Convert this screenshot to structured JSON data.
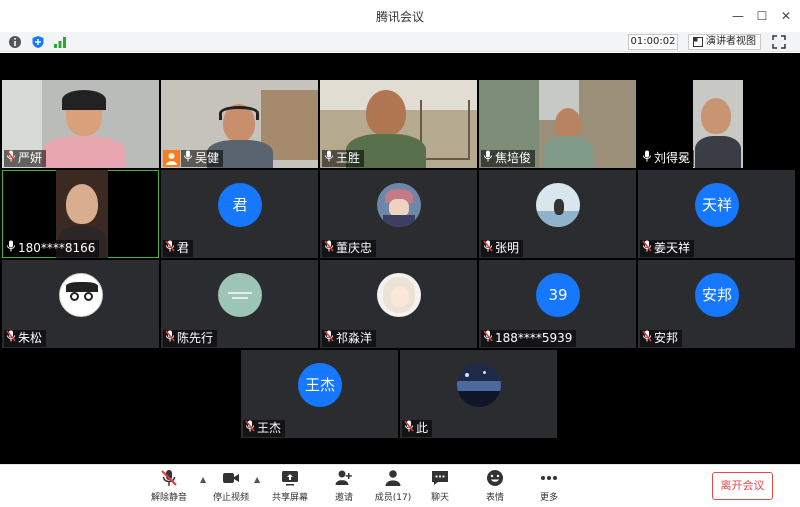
{
  "window": {
    "title": "腾讯会议",
    "minimize": "—",
    "maximize": "☐",
    "close": "✕"
  },
  "infobar": {
    "icons": [
      "info-icon",
      "shield-icon",
      "signal-icon"
    ],
    "timer": "01:00:02",
    "speaker_view": "演讲者视图",
    "fullscreen_icon": "fullscreen-icon"
  },
  "participants": [
    {
      "name": "严妍",
      "kind": "video",
      "muted": true
    },
    {
      "name": "吴健",
      "kind": "video",
      "muted": false,
      "host": true
    },
    {
      "name": "王胜",
      "kind": "video",
      "muted": false
    },
    {
      "name": "焦培俊",
      "kind": "video",
      "muted": false
    },
    {
      "name": "刘得冕",
      "kind": "video",
      "muted": false
    },
    {
      "name": "180****8166",
      "kind": "video",
      "muted": false,
      "active": true
    },
    {
      "name": "君",
      "kind": "avatar-text",
      "avatar_text": "君",
      "muted": true
    },
    {
      "name": "董庆忠",
      "kind": "avatar-image",
      "muted": true
    },
    {
      "name": "张明",
      "kind": "avatar-image",
      "muted": true
    },
    {
      "name": "姜天祥",
      "kind": "avatar-text",
      "avatar_text": "天祥",
      "muted": true
    },
    {
      "name": "朱松",
      "kind": "avatar-image",
      "muted": true
    },
    {
      "name": "陈先行",
      "kind": "avatar-image",
      "muted": true
    },
    {
      "name": "祁淼洋",
      "kind": "avatar-image",
      "muted": true
    },
    {
      "name": "188****5939",
      "kind": "avatar-text",
      "avatar_text": "39",
      "muted": true
    },
    {
      "name": "安邦",
      "kind": "avatar-text",
      "avatar_text": "安邦",
      "muted": true
    },
    {
      "name": "王杰",
      "kind": "avatar-text",
      "avatar_text": "王杰",
      "muted": true
    },
    {
      "name": "此",
      "kind": "avatar-image",
      "muted": true
    }
  ],
  "toolbar": {
    "unmute": "解除静音",
    "stop_video": "停止视频",
    "share_screen": "共享屏幕",
    "invite": "邀请",
    "members": "成员(17)",
    "chat": "聊天",
    "reactions": "表情",
    "more": "更多",
    "leave": "离开会议"
  },
  "colors": {
    "avatar_blue": "#1677ff",
    "leave_red": "#e14b4b",
    "active_border": "#43b244",
    "tile_bg": "#2b2c2f"
  }
}
